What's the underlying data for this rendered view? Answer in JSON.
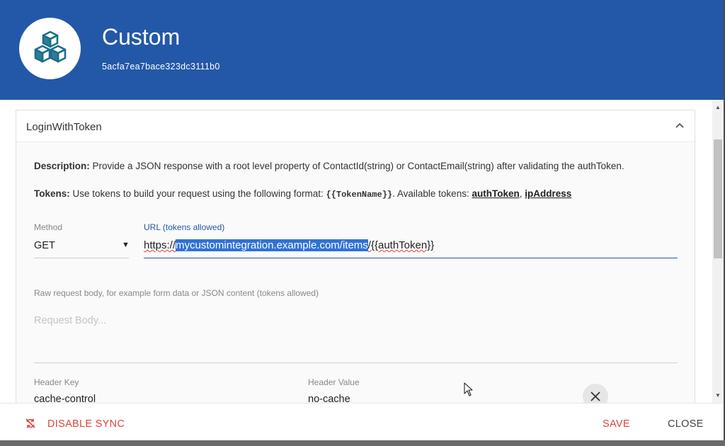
{
  "header": {
    "title": "Custom",
    "id": "5acfa7ea7bace323dc3111b0",
    "logo_icon": "cubes-icon",
    "background": "#2358a8"
  },
  "panel": {
    "title": "LoginWithToken",
    "collapse_icon": "chevron-up-icon",
    "description_label": "Description:",
    "description_text": "Provide a JSON response with a root level property of ContactId(string) or ContactEmail(string) after validating the authToken.",
    "tokens_label": "Tokens:",
    "tokens_text_before": "Use tokens to build your request using the following format:",
    "tokens_format": "{{TokenName}}",
    "tokens_text_after": ". Available tokens:",
    "tokens": [
      "authToken",
      "ipAddress"
    ],
    "tokens_separator": ","
  },
  "method": {
    "label": "Method",
    "value": "GET",
    "caret": "▼"
  },
  "url": {
    "label": "URL (tokens allowed)",
    "prefix": "https://",
    "selected": "mycustomintegration.example.com/items",
    "suffix": "/{{authToken}}"
  },
  "request_body": {
    "label": "Raw request body, for example form data or JSON content (tokens allowed)",
    "placeholder": "Request Body..."
  },
  "headers": [
    {
      "key_label": "Header Key",
      "key": "cache-control",
      "value_label": "Header Value",
      "value": "no-cache"
    }
  ],
  "footer": {
    "disable_sync": "DISABLE SYNC",
    "save": "SAVE",
    "close": "CLOSE",
    "accent": "#e0443a"
  }
}
